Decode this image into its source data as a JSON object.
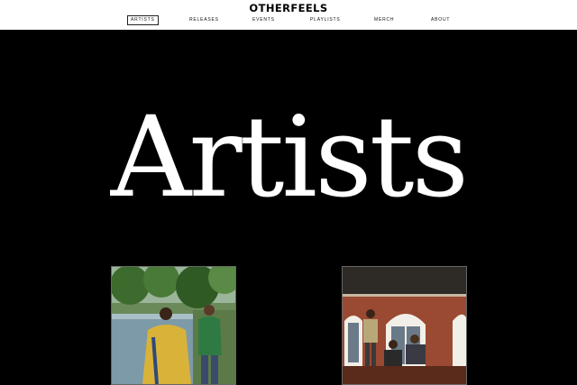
{
  "header": {
    "logo": "OTHERFEELS",
    "nav": [
      {
        "label": "ARTISTS",
        "active": true
      },
      {
        "label": "RELEASES",
        "active": false
      },
      {
        "label": "EVENTS",
        "active": false
      },
      {
        "label": "PLAYLISTS",
        "active": false
      },
      {
        "label": "MERCH",
        "active": false
      },
      {
        "label": "ABOUT",
        "active": false
      }
    ]
  },
  "main": {
    "title": "Artists"
  },
  "colors": {
    "background": "#000000",
    "header_background": "#ffffff",
    "title": "#ffffff"
  }
}
